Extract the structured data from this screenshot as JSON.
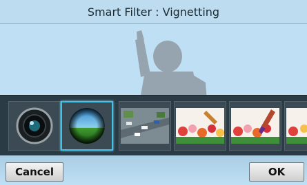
{
  "header": {
    "title": "Smart Filter : Vignetting"
  },
  "filters": [
    {
      "icon": "fisheye-lens-icon",
      "selected": false
    },
    {
      "icon": "vignetting-globe-icon",
      "selected": true
    },
    {
      "icon": "miniature-city-icon",
      "selected": false
    },
    {
      "icon": "painting-flowers-icon",
      "selected": false
    },
    {
      "icon": "painting-flowers-brush-icon",
      "selected": false
    },
    {
      "icon": "flowers-partial-icon",
      "selected": false
    }
  ],
  "footer": {
    "cancel_label": "Cancel",
    "ok_label": "OK"
  },
  "colors": {
    "accent": "#3fc3ea",
    "strip": "#2a3b45",
    "sky": "#bfe0f4"
  }
}
